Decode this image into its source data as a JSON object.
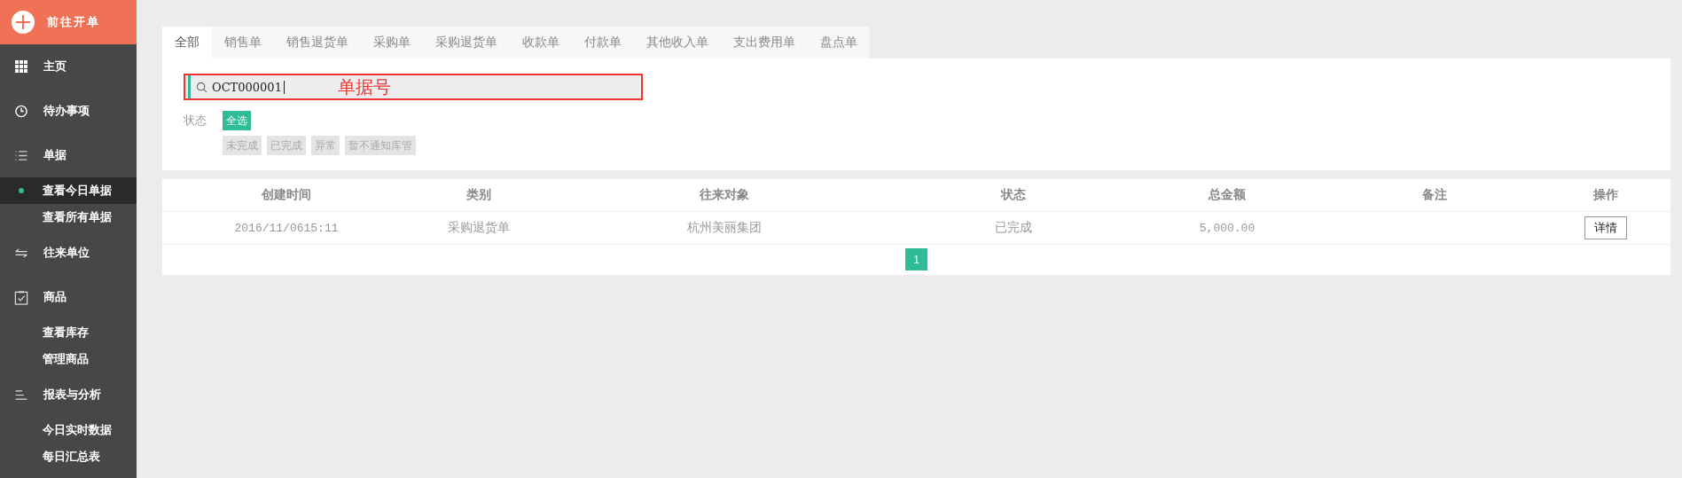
{
  "sidebar": {
    "new_order_button": "前往开单",
    "sections": [
      {
        "label": "主页"
      },
      {
        "label": "待办事项"
      },
      {
        "label": "单据",
        "children": [
          {
            "label": "查看今日单据",
            "selected": true
          },
          {
            "label": "查看所有单据",
            "selected": false
          }
        ]
      },
      {
        "label": "往来单位"
      },
      {
        "label": "商品",
        "children": [
          {
            "label": "查看库存",
            "selected": false
          },
          {
            "label": "管理商品",
            "selected": false
          }
        ]
      },
      {
        "label": "报表与分析",
        "children": [
          {
            "label": "今日实时数据",
            "selected": false
          },
          {
            "label": "每日汇总表",
            "selected": false
          }
        ]
      }
    ]
  },
  "tabs": [
    {
      "label": "全部",
      "selected": true
    },
    {
      "label": "销售单",
      "selected": false
    },
    {
      "label": "销售退货单",
      "selected": false
    },
    {
      "label": "采购单",
      "selected": false
    },
    {
      "label": "采购退货单",
      "selected": false
    },
    {
      "label": "收款单",
      "selected": false
    },
    {
      "label": "付款单",
      "selected": false
    },
    {
      "label": "其他收入单",
      "selected": false
    },
    {
      "label": "支出费用单",
      "selected": false
    },
    {
      "label": "盘点单",
      "selected": false
    }
  ],
  "search": {
    "value": "OCT000001",
    "annotation": "单据号"
  },
  "status_filter": {
    "label": "状态",
    "options": [
      {
        "label": "全选",
        "selected": true
      }
    ],
    "more_options": [
      {
        "label": "未完成",
        "selected": false
      },
      {
        "label": "已完成",
        "selected": false
      },
      {
        "label": "异常",
        "selected": false
      },
      {
        "label": "暂不通知库管",
        "selected": false
      }
    ]
  },
  "table": {
    "columns": [
      "创建时间",
      "类别",
      "往来对象",
      "状态",
      "总金额",
      "备注",
      "操作"
    ],
    "rows": [
      {
        "created": "2016/11/0615:11",
        "category": "采购退货单",
        "partner": "杭州美丽集团",
        "status": "已完成",
        "amount": "5,000.00",
        "action": "详情"
      }
    ]
  },
  "pagination": [
    {
      "label": "1",
      "selected": true
    }
  ]
}
